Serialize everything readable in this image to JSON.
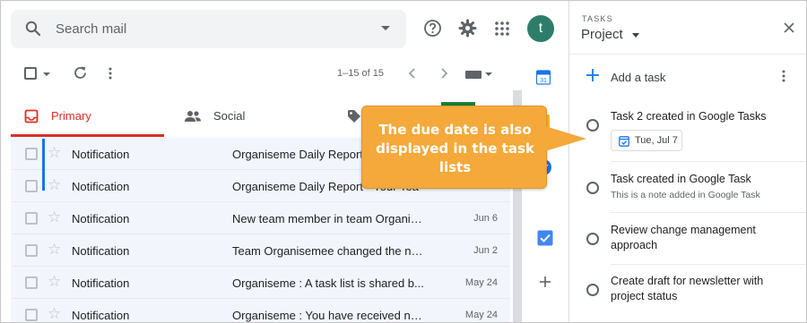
{
  "search": {
    "placeholder": "Search mail"
  },
  "user": {
    "avatar_letter": "t"
  },
  "toolbar": {
    "pager": "1–15 of 15"
  },
  "tabs": [
    {
      "label": "Primary",
      "active": true
    },
    {
      "label": "Social",
      "active": false
    }
  ],
  "mail": {
    "rows": [
      {
        "sender": "Notification",
        "subject": "Organiseme Daily Report - Your Tea",
        "date": ""
      },
      {
        "sender": "Notification",
        "subject": "Organiseme Daily Report - Your Tea",
        "date": ""
      },
      {
        "sender": "Notification",
        "subject": "New team member in team Organis...",
        "date": "Jun 6"
      },
      {
        "sender": "Notification",
        "subject": "Team Organisemee changed the na...",
        "date": "Jun 2"
      },
      {
        "sender": "Notification",
        "subject": "Organiseme : A task list is shared b...",
        "date": "May 24"
      },
      {
        "sender": "Notification",
        "subject": "Organiseme : You have received ne...",
        "date": "May 24"
      }
    ]
  },
  "tasks": {
    "header_small": "TASKS",
    "list_name": "Project",
    "add_label": "Add a task",
    "items": [
      {
        "title": "Task 2 created in Google Tasks",
        "note": "",
        "due": "Tue, Jul 7"
      },
      {
        "title": "Task created in Google Task",
        "note": "This is a note added in Google Task",
        "due": ""
      },
      {
        "title": "Review change management approach",
        "note": "",
        "due": ""
      },
      {
        "title": "Create draft for newsletter with project status",
        "note": "",
        "due": ""
      }
    ]
  },
  "callout": {
    "text": "The due date is also displayed in the task lists"
  },
  "colors": {
    "accent_red": "#d93025",
    "callout_orange": "#f4a93a",
    "google_blue": "#1a73e8",
    "avatar_green": "#2e7d6b"
  }
}
